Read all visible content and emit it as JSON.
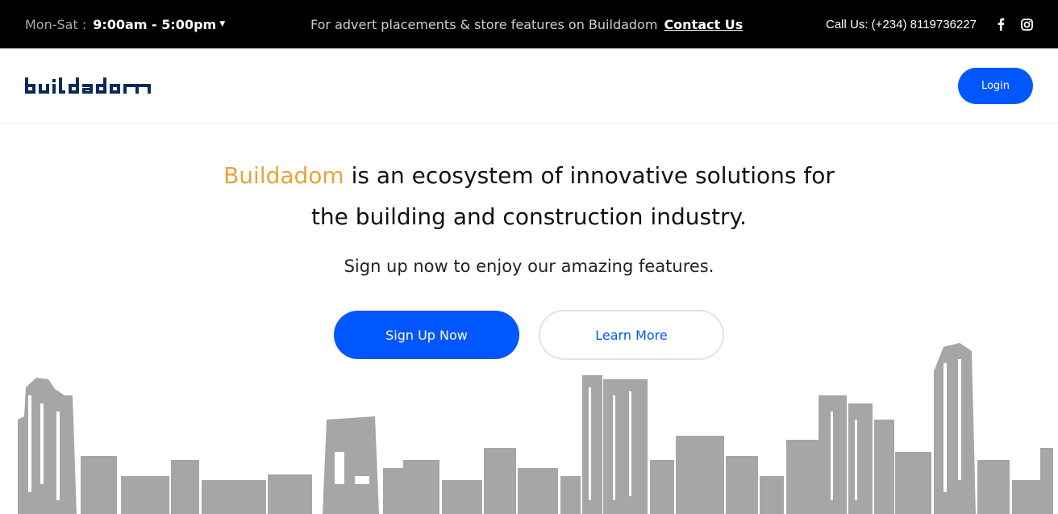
{
  "topbar": {
    "hours_label": "Mon-Sat :",
    "hours_value": "9:00am - 5:00pm",
    "promo_text": "For advert placements & store features on Buildadom",
    "promo_link": "Contact Us",
    "call_text": "Call Us: (+234) 8119736227",
    "social_icons": [
      "facebook-icon",
      "instagram-icon"
    ]
  },
  "header": {
    "logo_text": "buildadom",
    "login_label": "Login"
  },
  "hero": {
    "brand": "Buildadom",
    "headline_line1_rest": "is an ecosystem of innovative solutions for",
    "headline_line2": "the building and construction industry.",
    "subtext": "Sign up now to enjoy our amazing features.",
    "primary_cta": "Sign Up Now",
    "secondary_cta": "Learn More"
  },
  "colors": {
    "accent_blue": "#0057ff",
    "brand_orange": "#e8a33a",
    "logo_navy": "#0b2a5b",
    "skyline_gray": "#a6a6a6"
  }
}
